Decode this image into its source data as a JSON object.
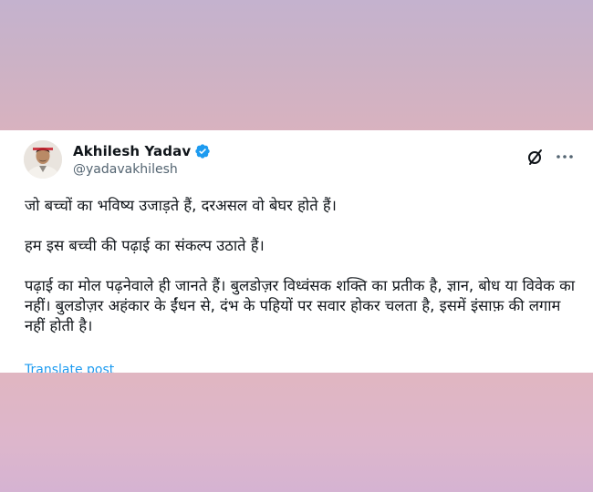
{
  "tweet": {
    "author": {
      "name": "Akhilesh Yadav",
      "handle": "@yadavakhilesh",
      "verified": true,
      "avatar_icon": "profile-photo"
    },
    "paragraphs": [
      "जो बच्चों का भविष्य उजाड़ते हैं, दरअसल वो बेघर होते हैं।",
      "हम इस बच्ची की पढ़ाई का संकल्प उठाते हैं।",
      "पढ़ाई का मोल पढ़नेवाले ही जानते हैं। बुलडोज़र विध्वंसक शक्ति का प्रतीक है, ज्ञान, बोध या विवेक का नहीं। बुलडोज़र अहंकार के ईंधन से, दंभ के पहियों पर सवार होकर चलता है, इसमें इंसाफ़ की लगाम नहीं होती है।"
    ],
    "translate_label": "Translate post",
    "icons": {
      "verified": "verified-badge-icon",
      "grok": "grok-icon",
      "more": "more-horizontal-icon"
    }
  },
  "colors": {
    "text_primary": "#0f1419",
    "text_secondary": "#536471",
    "accent": "#1d9bf0"
  }
}
